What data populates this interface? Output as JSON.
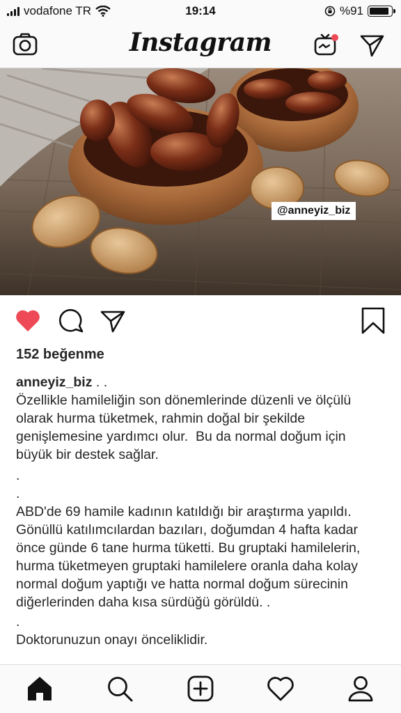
{
  "status_bar": {
    "carrier": "vodafone TR",
    "time": "19:14",
    "battery_text": "%91",
    "battery_level": 0.91
  },
  "header": {
    "brand": "Instagram",
    "left_icon": "camera-icon",
    "right_icons": [
      "igtv-icon",
      "direct-message-icon"
    ],
    "notification_dot_color": "#ed4956"
  },
  "post": {
    "image_watermark": "@anneyiz_biz",
    "actions": [
      "heart-icon",
      "comment-icon",
      "share-icon",
      "bookmark-icon"
    ],
    "liked": true,
    "like_color": "#ed4956",
    "likes_text": "152 beğenme",
    "caption_user": "anneyiz_biz",
    "caption_user_suffix": " . .",
    "caption_lines": [
      "Özellikle hamileliğin son dönemlerinde düzenli ve ölçülü olarak hurma tüketmek, rahmin doğal bir şekilde genişlemesine yardımcı olur.  Bu da normal doğum için büyük bir destek sağlar.",
      ".",
      ".",
      "ABD'de 69 hamile kadının katıldığı bir araştırma yapıldı. Gönüllü katılımcılardan bazıları, doğumdan 4 hafta kadar önce günde 6 tane hurma tüketti. Bu gruptaki hamilelerin,  hurma tüketmeyen gruptaki hamilelere oranla daha kolay normal doğum yaptığı ve hatta normal doğum sürecinin diğerlerinden daha kısa sürdüğü görüldü. .",
      ".",
      "Doktorunuzun onayı önceliklidir."
    ]
  },
  "bottom_nav": {
    "items": [
      "home-icon",
      "search-icon",
      "add-post-icon",
      "activity-heart-icon",
      "profile-icon"
    ],
    "active": "home-icon"
  }
}
